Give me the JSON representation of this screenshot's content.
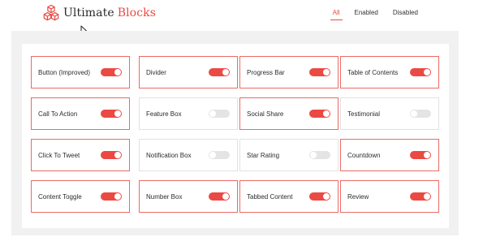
{
  "brand": {
    "name": "Ultimate",
    "accent_word": "Blocks",
    "logo_icon": "cubes-icon",
    "accent_color": "#ea4a43"
  },
  "filters": [
    {
      "label": "All",
      "active": true
    },
    {
      "label": "Enabled",
      "active": false
    },
    {
      "label": "Disabled",
      "active": false
    }
  ],
  "blocks": [
    {
      "label": "Button (Improved)",
      "enabled": true
    },
    {
      "label": "Divider",
      "enabled": true
    },
    {
      "label": "Progress Bar",
      "enabled": true
    },
    {
      "label": "Table of Contents",
      "enabled": true
    },
    {
      "label": "Call To Action",
      "enabled": true
    },
    {
      "label": "Feature Box",
      "enabled": false
    },
    {
      "label": "Social Share",
      "enabled": true
    },
    {
      "label": "Testimonial",
      "enabled": false
    },
    {
      "label": "Click To Tweet",
      "enabled": true
    },
    {
      "label": "Notification Box",
      "enabled": false
    },
    {
      "label": "Star Rating",
      "enabled": false
    },
    {
      "label": "Countdown",
      "enabled": true
    },
    {
      "label": "Content Toggle",
      "enabled": true
    },
    {
      "label": "Number Box",
      "enabled": true
    },
    {
      "label": "Tabbed Content",
      "enabled": true
    },
    {
      "label": "Review",
      "enabled": true
    }
  ]
}
